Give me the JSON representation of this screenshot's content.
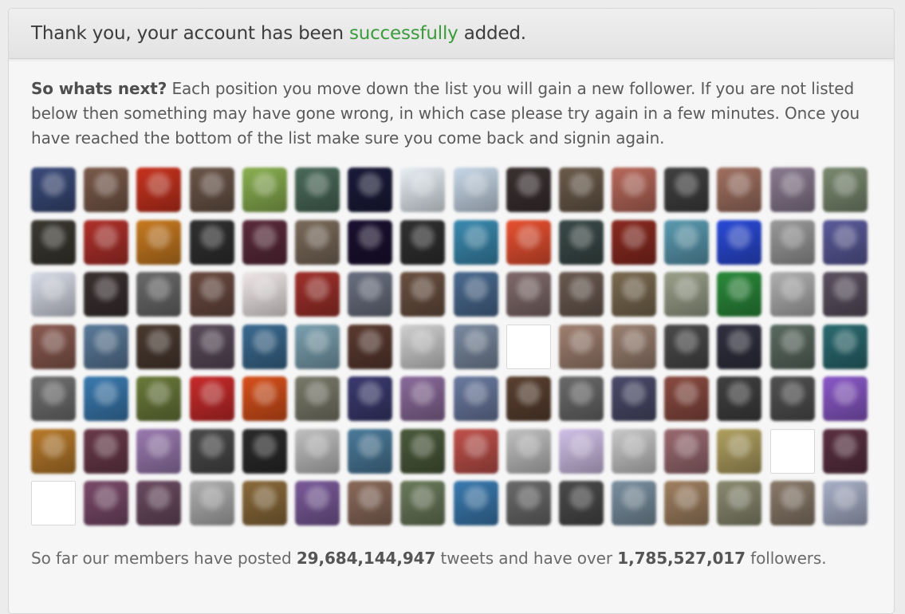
{
  "header": {
    "text_before": "Thank you, your account has been ",
    "highlight": "successfully",
    "text_after": " added."
  },
  "intro": {
    "lead": "So whats next?",
    "text": " Each position you move down the list you will gain a new follower. If you are not listed below then something may have gone wrong, in which case please try again in a few minutes. Once you have reached the bottom of the list make sure you come back and signin again."
  },
  "stats": {
    "prefix": "So far our members have posted ",
    "tweets": "29,684,144,947",
    "middle": " tweets and have over ",
    "followers": "1,785,527,017",
    "suffix": " followers."
  },
  "colors": {
    "accent_green": "#3b9c3b",
    "avatars": [
      "#3a4a7a",
      "#7a5a4a",
      "#c8321e",
      "#6a5548",
      "#8ab050",
      "#4a6a5a",
      "#1a1a3a",
      "#e8f0f6",
      "#c8d8e8",
      "#3a3030",
      "#6a5a4a",
      "#b8685a",
      "#404040",
      "#a07060",
      "#8a7a90",
      "#7a8a70",
      "#3a3830",
      "#b0302a",
      "#c87a20",
      "#303030",
      "#5a2a3a",
      "#7a6a5a",
      "#1a1030",
      "#303030",
      "#3a8ab0",
      "#e85030",
      "#3a4a48",
      "#8a2a20",
      "#5a9ab0",
      "#2a4ad8",
      "#9a9a9a",
      "#5a5a9a",
      "#d8dce8",
      "#3a3030",
      "#6a6a6a",
      "#6a4a40",
      "#f0e8e8",
      "#a0302a",
      "#6a7080",
      "#6a5040",
      "#4a6a90",
      "#806a6a",
      "#6a5a50",
      "#7a6a50",
      "#9aa08a",
      "#2a8a3a",
      "#b0b0b0",
      "#5a5060",
      "#8a5a50",
      "#5a7a9a",
      "#4a3a30",
      "#5a4a5a",
      "#3a6a90",
      "#7aa0b0",
      "#5a3a30",
      "#d0d0d0",
      "#7a8aa0",
      "#ffffff",
      "#a08070",
      "#9a8070",
      "#4a4a4a",
      "#303040",
      "#5a6a60",
      "#2a6a70",
      "#707070",
      "#3a7ab0",
      "#6a7a3a",
      "#c82a2a",
      "#d8501a",
      "#7a7a6a",
      "#3a3a70",
      "#8a6a9a",
      "#6a7aa0",
      "#5a4030",
      "#6a6a6a",
      "#4a4a6a",
      "#8a4a40",
      "#404040",
      "#505050",
      "#8a58c8",
      "#b87a2a",
      "#6a3a4a",
      "#9a7ab0",
      "#4a4a4a",
      "#2a2a2a",
      "#c0c0c0",
      "#4a7a9a",
      "#4a5a3a",
      "#c0504a",
      "#c0c0c0",
      "#d0c0e8",
      "#c8c8c8",
      "#9a6a70",
      "#b0a060",
      "#ffffff",
      "#5a3040",
      "#ffffff",
      "#7a4a6a",
      "#6a4a60",
      "#b0b0b0",
      "#8a6a3a",
      "#7a5a9a",
      "#8a6a5a",
      "#6a7a5a",
      "#3a7ab0",
      "#6a6a6a",
      "#4a4a4a",
      "#7a90a0",
      "#a08060",
      "#8a8a70",
      "#8a7a6a",
      "#a8b0c8"
    ]
  },
  "avatar_blank_indices": [
    57,
    94,
    96
  ]
}
